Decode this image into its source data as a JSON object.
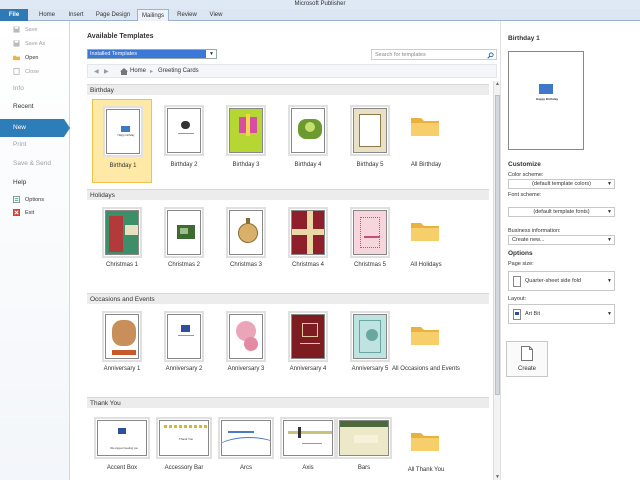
{
  "window": {
    "title": "Microsoft Publisher"
  },
  "ribbon": {
    "tabs": [
      "File",
      "Home",
      "Insert",
      "Page Design",
      "Mailings",
      "Review",
      "View"
    ]
  },
  "nav": {
    "save": "Save",
    "save_as": "Save As",
    "open": "Open",
    "close": "Close",
    "info": "Info",
    "recent": "Recent",
    "new": "New",
    "print": "Print",
    "save_send": "Save & Send",
    "help": "Help",
    "options": "Options",
    "exit": "Exit"
  },
  "main": {
    "heading": "Available Templates",
    "source_selected": "Installed Templates",
    "search_placeholder": "Search for templates",
    "breadcrumb": {
      "home": "Home",
      "current": "Greeting Cards"
    },
    "sections": [
      {
        "title": "Birthday",
        "items": [
          "Birthday 1",
          "Birthday 2",
          "Birthday 3",
          "Birthday 4",
          "Birthday 5"
        ],
        "all_label": "All Birthday"
      },
      {
        "title": "Holidays",
        "items": [
          "Christmas 1",
          "Christmas 2",
          "Christmas 3",
          "Christmas 4",
          "Christmas 5"
        ],
        "all_label": "All Holidays"
      },
      {
        "title": "Occasions and Events",
        "items": [
          "Anniversary 1",
          "Anniversary 2",
          "Anniversary 3",
          "Anniversary 4",
          "Anniversary 5"
        ],
        "all_label": "All Occasions and Events"
      },
      {
        "title": "Thank You",
        "items": [
          "Accent Box",
          "Accessory Bar",
          "Arcs",
          "Axis",
          "Bars"
        ],
        "all_label": "All Thank You"
      }
    ],
    "thumb_text": {
      "happy_birthday": "Happy birthday",
      "thank_you": "Thank You",
      "accent_box_note": "We enjoyed meeting you"
    }
  },
  "right": {
    "template_name": "Birthday 1",
    "preview_text": "Happy Birthday",
    "customize": "Customize",
    "color_scheme_label": "Color scheme:",
    "color_scheme_value": "(default template colors)",
    "font_scheme_label": "Font scheme:",
    "font_scheme_value": "(default template fonts)",
    "business_info_label": "Business information:",
    "business_info_value": "Create new...",
    "options": "Options",
    "page_size_label": "Page size:",
    "page_size_value": "Quarter-sheet side fold",
    "layout_label": "Layout:",
    "layout_value": "Art Bit",
    "create": "Create"
  },
  "colors": {
    "accent": "#2d7db8",
    "selected_tile": "#ffe9a6",
    "selected_tile_border": "#f0c24a",
    "folder": "#f2c14e"
  }
}
